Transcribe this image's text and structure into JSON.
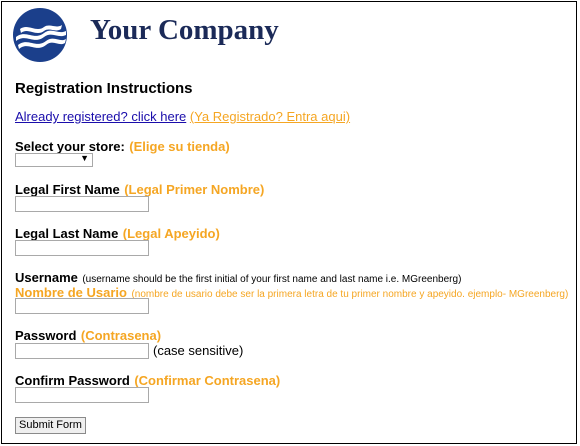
{
  "header": {
    "company_name": "Your Company",
    "logo": "company-logo"
  },
  "page": {
    "heading": "Registration Instructions",
    "already_registered_link": "Already registered? click here",
    "already_registered_link_es": "(Ya Registrado? Entra aqui)"
  },
  "fields": {
    "store": {
      "label": "Select your store:",
      "label_es": "(Elige su tienda)",
      "selected_value": ""
    },
    "first_name": {
      "label": "Legal First Name",
      "label_es": "(Legal Primer Nombre)",
      "value": ""
    },
    "last_name": {
      "label": "Legal Last Name",
      "label_es": "(Legal Apeyido)",
      "value": ""
    },
    "username": {
      "label": "Username",
      "note": "(username should be the first initial of your first name and last name i.e. MGreenberg)",
      "label_es": "Nombre de Usario",
      "note_es": "(nombre de usario debe ser la primera letra de tu primer nombre y apeyido. ejemplo- MGreenberg)",
      "value": ""
    },
    "password": {
      "label": "Password",
      "label_es": "(Contrasena)",
      "hint": "(case sensitive)",
      "value": ""
    },
    "confirm_password": {
      "label": "Confirm Password",
      "label_es": "(Confirmar Contrasena)",
      "value": ""
    }
  },
  "actions": {
    "submit_label": "Submit Form"
  },
  "colors": {
    "accent_orange": "#f5a623",
    "link_blue": "#1a0dab",
    "brand_navy": "#1b2a58"
  }
}
